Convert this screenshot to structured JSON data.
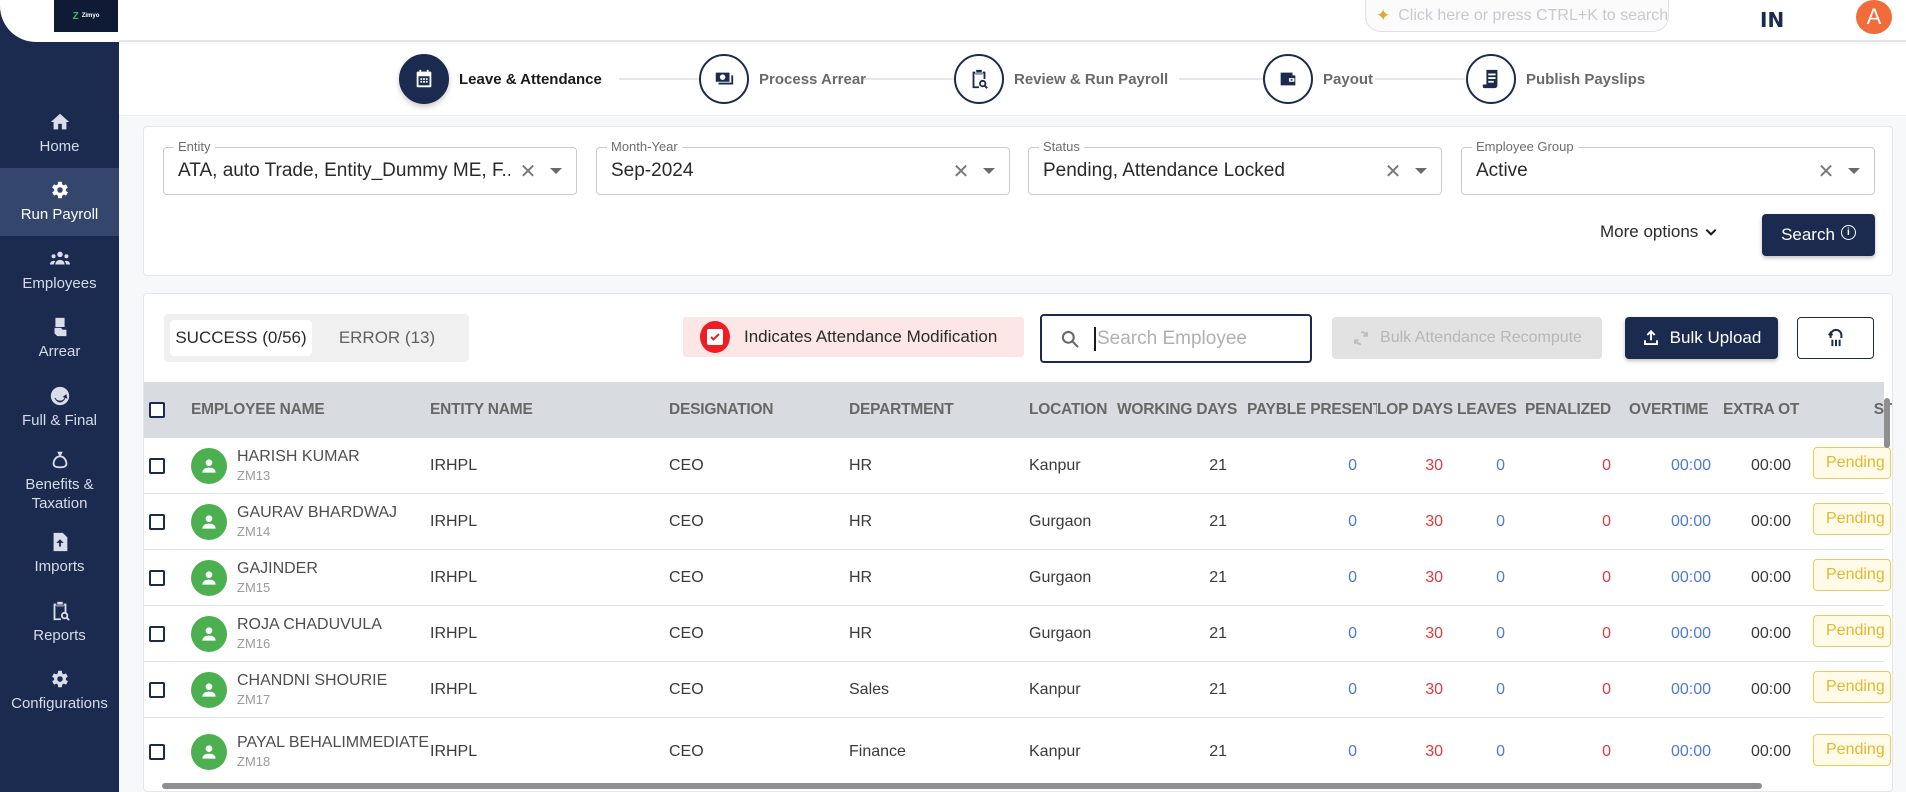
{
  "app": {
    "logo_text": "Zimyo",
    "logo_mark": "Z"
  },
  "sidebar": {
    "items": [
      {
        "label": "Home",
        "icon": "home-icon"
      },
      {
        "label": "Run Payroll",
        "icon": "gear-icon",
        "active": true
      },
      {
        "label": "Employees",
        "icon": "users-icon"
      },
      {
        "label": "Arrear",
        "icon": "money-hand-icon"
      },
      {
        "label": "Full & Final",
        "icon": "refresh-arrow-icon"
      },
      {
        "label": "Benefits & Taxation",
        "icon": "money-bag-icon"
      },
      {
        "label": "Imports",
        "icon": "file-upload-icon"
      },
      {
        "label": "Reports",
        "icon": "report-search-icon"
      },
      {
        "label": "Configurations",
        "icon": "settings-icon"
      }
    ]
  },
  "header": {
    "search_placeholder": "Click here or press CTRL+K to search",
    "language": "IN",
    "avatar_initial": "A",
    "avatar_color": "#f26b3a"
  },
  "stepper": {
    "steps": [
      {
        "label": "Leave & Attendance",
        "icon": "calendar-icon",
        "active": true
      },
      {
        "label": "Process Arrear",
        "icon": "cash-icon"
      },
      {
        "label": "Review & Run Payroll",
        "icon": "clipboard-search-icon"
      },
      {
        "label": "Payout",
        "icon": "wallet-icon"
      },
      {
        "label": "Publish Payslips",
        "icon": "receipt-icon"
      }
    ]
  },
  "filters": {
    "entity": {
      "label": "Entity",
      "value": "ATA, auto Trade, Entity_Dummy ME, F..."
    },
    "month_year": {
      "label": "Month-Year",
      "value": "Sep-2024"
    },
    "status": {
      "label": "Status",
      "value": "Pending, Attendance Locked"
    },
    "employee_group": {
      "label": "Employee Group",
      "value": "Active"
    },
    "more_options_label": "More options",
    "search_label": "Search"
  },
  "table_toolbar": {
    "tabs": [
      {
        "label": "SUCCESS (0/56)",
        "active": true
      },
      {
        "label": "ERROR (13)",
        "active": false
      }
    ],
    "legend_text": "Indicates Attendance Modification",
    "search_placeholder": "Search Employee",
    "search_value": "",
    "recompute_label": "Bulk Attendance Recompute",
    "upload_label": "Bulk Upload"
  },
  "table": {
    "columns": [
      "EMPLOYEE NAME",
      "ENTITY NAME",
      "DESIGNATION",
      "DEPARTMENT",
      "LOCATION",
      "WORKING DAYS",
      "PAYBLE PRESENT",
      "LOP DAYS",
      "LEAVES",
      "PENALIZED",
      "OVERTIME",
      "EXTRA OT",
      "STA"
    ],
    "rows": [
      {
        "name": "HARISH KUMAR",
        "id": "ZM13",
        "entity": "IRHPL",
        "designation": "CEO",
        "department": "HR",
        "location": "Kanpur",
        "working_days": "21",
        "payable_present": "0",
        "lop_days": "30",
        "leaves": "0",
        "penalized": "0",
        "overtime": "00:00",
        "extra_ot": "00:00",
        "status": "Pending"
      },
      {
        "name": "GAURAV BHARDWAJ",
        "id": "ZM14",
        "entity": "IRHPL",
        "designation": "CEO",
        "department": "HR",
        "location": "Gurgaon",
        "working_days": "21",
        "payable_present": "0",
        "lop_days": "30",
        "leaves": "0",
        "penalized": "0",
        "overtime": "00:00",
        "extra_ot": "00:00",
        "status": "Pending"
      },
      {
        "name": "GAJINDER",
        "id": "ZM15",
        "entity": "IRHPL",
        "designation": "CEO",
        "department": "HR",
        "location": "Gurgaon",
        "working_days": "21",
        "payable_present": "0",
        "lop_days": "30",
        "leaves": "0",
        "penalized": "0",
        "overtime": "00:00",
        "extra_ot": "00:00",
        "status": "Pending"
      },
      {
        "name": "ROJA CHADUVULA",
        "id": "ZM16",
        "entity": "IRHPL",
        "designation": "CEO",
        "department": "HR",
        "location": "Gurgaon",
        "working_days": "21",
        "payable_present": "0",
        "lop_days": "30",
        "leaves": "0",
        "penalized": "0",
        "overtime": "00:00",
        "extra_ot": "00:00",
        "status": "Pending"
      },
      {
        "name": "CHANDNI SHOURIE",
        "id": "ZM17",
        "entity": "IRHPL",
        "designation": "CEO",
        "department": "Sales",
        "location": "Kanpur",
        "working_days": "21",
        "payable_present": "0",
        "lop_days": "30",
        "leaves": "0",
        "penalized": "0",
        "overtime": "00:00",
        "extra_ot": "00:00",
        "status": "Pending"
      },
      {
        "name": "PAYAL BEHALIMMEDIATE...",
        "id": "ZM18",
        "entity": "IRHPL",
        "designation": "CEO",
        "department": "Finance",
        "location": "Kanpur",
        "working_days": "21",
        "payable_present": "0",
        "lop_days": "30",
        "leaves": "0",
        "penalized": "0",
        "overtime": "00:00",
        "extra_ot": "00:00",
        "status": "Pending"
      }
    ]
  },
  "colors": {
    "brand_navy": "#1b2b4f",
    "value_blue": "#4b79d6",
    "value_red": "#e03a3a",
    "pending_yellow": "#e2b830",
    "avatar_green": "#4caf50"
  }
}
